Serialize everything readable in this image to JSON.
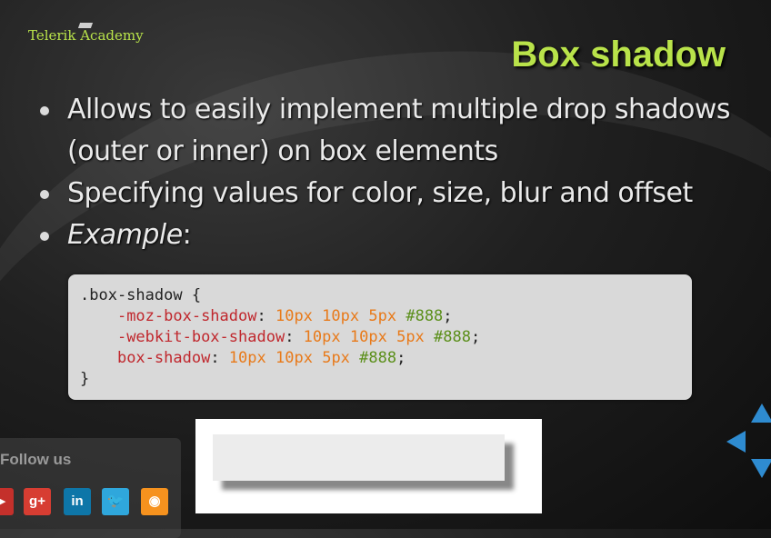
{
  "logo": {
    "text": "Telerik Academy"
  },
  "slide": {
    "title": "Box shadow",
    "bullets": [
      {
        "text": "Allows to easily implement multiple drop shadows (outer or inner) on box elements"
      },
      {
        "text": "Specifying values for color, size, blur and offset"
      },
      {
        "text_italic": "Example",
        "text_suffix": ":"
      }
    ]
  },
  "code": {
    "line1": ".box-shadow {",
    "line2": {
      "prop": "-moz-box-shadow",
      "colon": ": ",
      "v1": "10px",
      "v2": "10px",
      "v3": "5px",
      "hex": "#888",
      "end": ";"
    },
    "line3": {
      "prop": "-webkit-box-shadow",
      "colon": ": ",
      "v1": "10px",
      "v2": "10px",
      "v3": "5px",
      "hex": "#888",
      "end": ";"
    },
    "line4": {
      "prop": "box-shadow",
      "colon": ": ",
      "v1": "10px",
      "v2": "10px",
      "v3": "5px",
      "hex": "#888",
      "end": ";"
    },
    "line5": "}"
  },
  "follow": {
    "label": "Follow us",
    "icons": [
      {
        "name": "youtube-icon",
        "glyph": "▶",
        "color": "#c4302b"
      },
      {
        "name": "google-plus-icon",
        "glyph": "g+",
        "color": "#d73d32"
      },
      {
        "name": "linkedin-icon",
        "glyph": "in",
        "color": "#0e76a8"
      },
      {
        "name": "twitter-icon",
        "glyph": "🐦",
        "color": "#2fa7dc"
      },
      {
        "name": "rss-icon",
        "glyph": "◉",
        "color": "#f6921e"
      }
    ]
  },
  "colors": {
    "accent": "#b9e34a",
    "nav": "#2e8bd0"
  }
}
